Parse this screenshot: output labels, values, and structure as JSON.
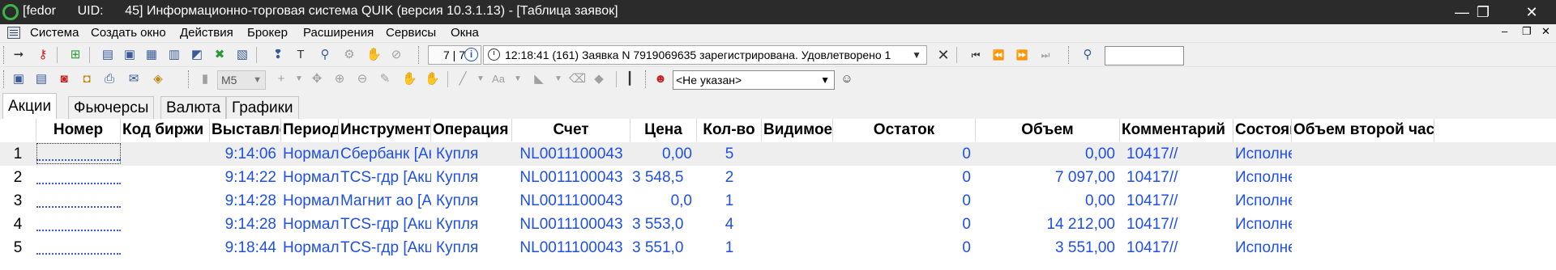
{
  "window": {
    "title": "[fedor      UID:      45] Информационно-торговая система QUIK (версия 10.3.1.13) - [Таблица заявок]",
    "minimize_glyph": "—",
    "maximize_glyph": "❐",
    "close_glyph": "✕"
  },
  "menu": {
    "items": [
      "Система",
      "Создать окно",
      "Действия",
      "Брокер",
      "Расширения",
      "Сервисы",
      "Окна"
    ]
  },
  "toolbar1": {
    "counter": "7 | 7",
    "message_time": "12:18:41",
    "message": "12:18:41  (161) Заявка N 7919069635 зарегистрирована. Удовлетворено 1",
    "search_value": ""
  },
  "toolbar2": {
    "interval": "M5",
    "font_label": "Aa",
    "client_select": "<Не указан>"
  },
  "tabs": [
    "Акции",
    "Фьючерсы",
    "Валюта",
    "Графики"
  ],
  "active_tab": "Акции",
  "table": {
    "columns": [
      "Номер",
      "Код биржи",
      "Выставлена",
      "Период",
      "Инструмент",
      "Операция",
      "Счет",
      "Цена",
      "Кол-во",
      "Видимое",
      "Остаток",
      "Объем",
      "Комментарий",
      "Состояние",
      "Объем второй части"
    ],
    "rows": [
      {
        "n": "1",
        "time": "9:14:06",
        "period": "Нормальный",
        "instrument": "Сбербанк [Акции]",
        "op": "Купля",
        "account": "NL0011100043",
        "price": "0,00",
        "qty": "5",
        "rest": "0",
        "volume": "0,00",
        "comment": "10417//",
        "state": "Исполнена"
      },
      {
        "n": "2",
        "time": "9:14:22",
        "period": "Нормальный",
        "instrument": "TCS-гдр [Акции]",
        "op": "Купля",
        "account": "NL0011100043",
        "price": "3 548,5",
        "qty": "2",
        "rest": "0",
        "volume": "7 097,00",
        "comment": "10417//",
        "state": "Исполнена"
      },
      {
        "n": "3",
        "time": "9:14:28",
        "period": "Нормальный",
        "instrument": "Магнит ао [Акции]",
        "op": "Купля",
        "account": "NL0011100043",
        "price": "0,0",
        "qty": "1",
        "rest": "0",
        "volume": "0,00",
        "comment": "10417//",
        "state": "Исполнена"
      },
      {
        "n": "4",
        "time": "9:14:28",
        "period": "Нормальный",
        "instrument": "TCS-гдр [Акции]",
        "op": "Купля",
        "account": "NL0011100043",
        "price": "3 553,0",
        "qty": "4",
        "rest": "0",
        "volume": "14 212,00",
        "comment": "10417//",
        "state": "Исполнена"
      },
      {
        "n": "5",
        "time": "9:18:44",
        "period": "Нормальный",
        "instrument": "TCS-гдр [Акции]",
        "op": "Купля",
        "account": "NL0011100043",
        "price": "3 551,0",
        "qty": "1",
        "rest": "0",
        "volume": "3 551,00",
        "comment": "10417//",
        "state": "Исполнена"
      }
    ]
  },
  "colors": {
    "data_text": "#1f4fe6",
    "titlebar": "#2b2b2b",
    "logo": "#3bb54a"
  },
  "icons": {
    "toolbar1": [
      "connect-icon",
      "key-icon",
      "new-order-icon",
      "table-icon",
      "tt-icon",
      "doc-icon",
      "report-icon",
      "quotes-icon",
      "trades-icon",
      "limits-icon",
      "alert-icon",
      "text-icon",
      "pin-icon",
      "gear-icon",
      "hand-icon",
      "stop-icon",
      "cancel-icon",
      "first-icon",
      "prev-icon",
      "next-icon",
      "last-icon",
      "search-icon"
    ]
  }
}
